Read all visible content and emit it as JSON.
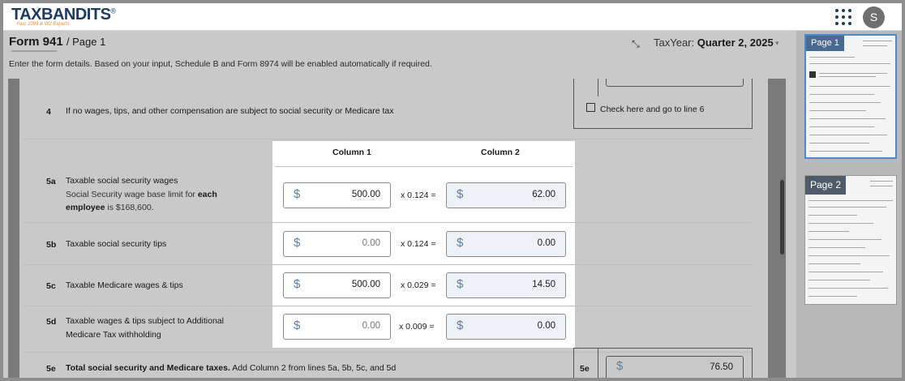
{
  "header": {
    "logo_text": "TAXBANDITS",
    "logo_registered": "®",
    "tagline": "Your 1099 & W2 Experts",
    "user_initial": "S"
  },
  "page": {
    "form_title": "Form 941",
    "page_label": "/ Page 1",
    "taxyear_label": "TaxYear:",
    "taxyear_value": "Quarter 2, 2025",
    "description": "Enter the form details. Based on your input, Schedule B and Form 8974 will be enabled automatically if required."
  },
  "form": {
    "line4": {
      "code": "4",
      "text": "If no wages, tips, and other compensation are subject to social security or Medicare tax",
      "checkbox_label": "Check here and go to line 6"
    },
    "columns": {
      "col1": "Column 1",
      "col2": "Column 2"
    },
    "rows": [
      {
        "code": "5a",
        "text": "Taxable social security wages",
        "sub1": "Social Security wage base limit for ",
        "sub_bold": "each employee",
        "sub2": " is $168,600.",
        "col1": "500.00",
        "rate": "x 0.124 =",
        "col2": "62.00"
      },
      {
        "code": "5b",
        "text": "Taxable social security tips",
        "col1": "0.00",
        "rate": "x 0.124 =",
        "col2": "0.00"
      },
      {
        "code": "5c",
        "text": "Taxable Medicare wages & tips",
        "col1": "500.00",
        "rate": "x 0.029 =",
        "col2": "14.50"
      },
      {
        "code": "5d",
        "text_line1": "Taxable wages & tips subject to Additional",
        "text_line2": "Medicare Tax withholding",
        "col1": "0.00",
        "rate": "x 0.009 =",
        "col2": "0.00"
      }
    ],
    "line5e": {
      "code": "5e",
      "text_bold": "Total social security and Medicare taxes.",
      "text_rest": " Add Column 2 from lines 5a, 5b, 5c, and 5d",
      "box_code": "5e",
      "value": "76.50"
    },
    "currency_symbol": "$"
  },
  "sidebar": {
    "thumbnails": [
      {
        "label": "Page 1"
      },
      {
        "label": "Page 2"
      }
    ]
  }
}
